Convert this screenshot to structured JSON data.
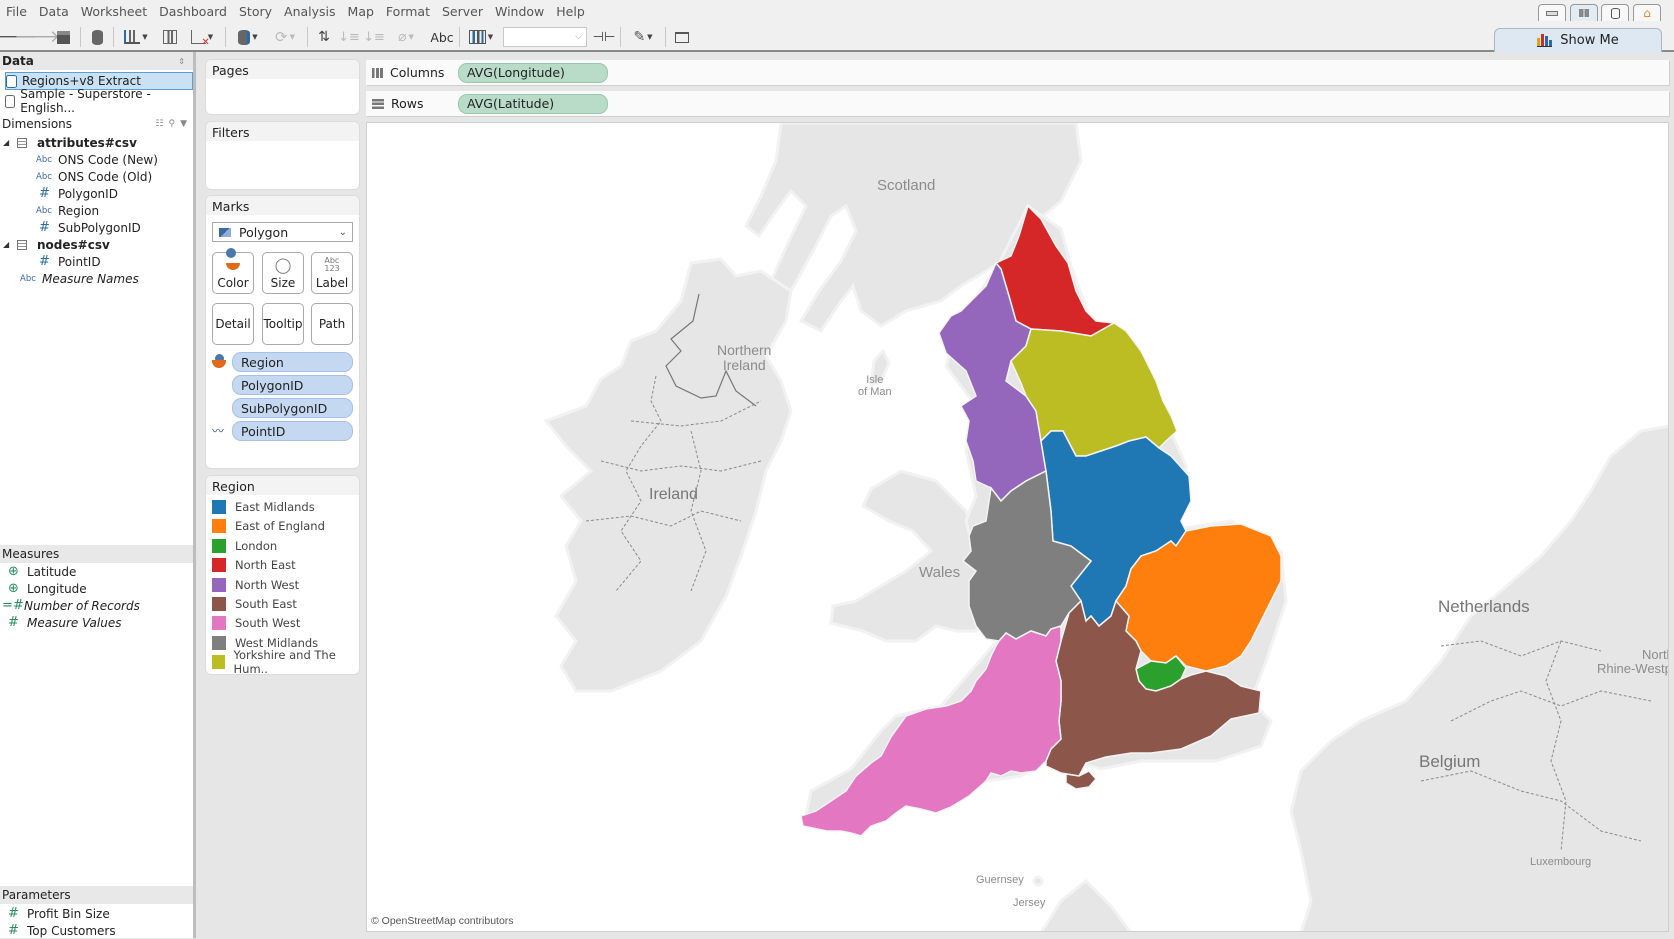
{
  "menu": [
    "File",
    "Data",
    "Worksheet",
    "Dashboard",
    "Story",
    "Analysis",
    "Map",
    "Format",
    "Server",
    "Window",
    "Help"
  ],
  "toolbar": {
    "label_button": "Abc",
    "fit_dropdown_value": "",
    "show_me": "Show Me"
  },
  "data_panel": {
    "title": "Data",
    "datasources": [
      {
        "name": "Regions+v8 Extract",
        "selected": true
      },
      {
        "name": "Sample - Superstore - English...",
        "selected": false
      }
    ],
    "dimensions_title": "Dimensions",
    "tables": [
      {
        "name": "attributes#csv",
        "fields": [
          {
            "type": "Abc",
            "name": "ONS Code (New)"
          },
          {
            "type": "Abc",
            "name": "ONS Code (Old)"
          },
          {
            "type": "#",
            "name": "PolygonID"
          },
          {
            "type": "Abc",
            "name": "Region"
          },
          {
            "type": "#",
            "name": "SubPolygonID"
          }
        ]
      },
      {
        "name": "nodes#csv",
        "fields": [
          {
            "type": "#",
            "name": "PointID"
          }
        ]
      }
    ],
    "measure_names": "Measure Names",
    "measures_title": "Measures",
    "measures": [
      "Latitude",
      "Longitude",
      "Number of Records",
      "Measure Values"
    ],
    "parameters_title": "Parameters",
    "parameters": [
      "Profit Bin Size",
      "Top Customers"
    ]
  },
  "cards": {
    "pages": "Pages",
    "filters": "Filters",
    "marks": "Marks",
    "mark_type": "Polygon",
    "mark_buttons": [
      "Color",
      "Size",
      "Label",
      "Detail",
      "Tooltip",
      "Path"
    ],
    "mark_pills": [
      "Region",
      "PolygonID",
      "SubPolygonID",
      "PointID"
    ]
  },
  "shelves": {
    "columns_label": "Columns",
    "columns_pill": "AVG(Longitude)",
    "rows_label": "Rows",
    "rows_pill": "AVG(Latitude)"
  },
  "legend": {
    "title": "Region",
    "items": [
      {
        "name": "East Midlands",
        "color": "#1f77b4"
      },
      {
        "name": "East of England",
        "color": "#ff7f0e"
      },
      {
        "name": "London",
        "color": "#2ca02c"
      },
      {
        "name": "North East",
        "color": "#d62728"
      },
      {
        "name": "North West",
        "color": "#9467bd"
      },
      {
        "name": "South East",
        "color": "#8c564b"
      },
      {
        "name": "South West",
        "color": "#e377c2"
      },
      {
        "name": "West Midlands",
        "color": "#7f7f7f"
      },
      {
        "name": "Yorkshire and The Hum..",
        "color": "#bcbd22"
      }
    ]
  },
  "map": {
    "labels": {
      "scotland": "Scotland",
      "northern_ireland_1": "Northern",
      "northern_ireland_2": "Ireland",
      "isle_of_man_1": "Isle",
      "isle_of_man_2": "of Man",
      "ireland": "Ireland",
      "wales": "Wales",
      "netherlands": "Netherlands",
      "nrw_1": "North",
      "nrw_2": "Rhine-Westphalia",
      "belgium": "Belgium",
      "luxembourg": "Luxembourg",
      "guernsey": "Guernsey",
      "jersey": "Jersey"
    },
    "attribution": "© OpenStreetMap contributors"
  }
}
